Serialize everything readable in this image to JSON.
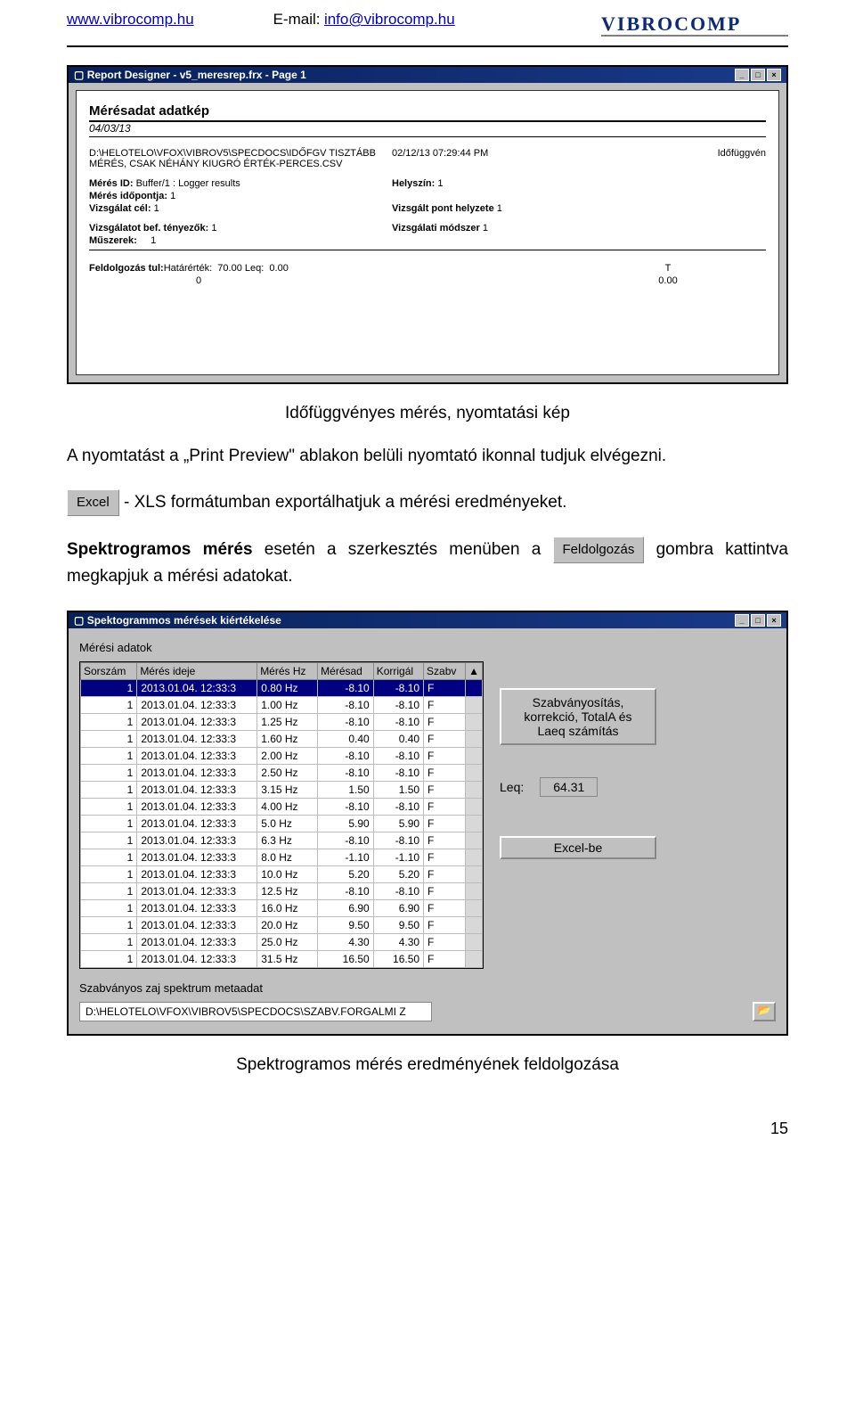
{
  "header": {
    "site_url": "www.vibrocomp.hu",
    "email_label": "E-mail:",
    "email": "info@vibrocomp.hu",
    "logo_text": "VIBROCOMP"
  },
  "win1": {
    "title": "Report Designer - v5_meresrep.frx - Page 1",
    "report": {
      "heading": "Mérésadat adatkép",
      "date": "04/03/13",
      "path1": "D:\\HELOTELO\\VFOX\\VIBROV5\\SPECDOCS\\IDŐFGV TISZTÁBB",
      "path2": "MÉRÉS, CSAK NÉHÁNY KIUGRÓ ÉRTÉK-PERCES.CSV",
      "right_ts": "02/12/13 07:29:44 PM",
      "right_type": "Időfüggvén",
      "meres_id_l": "Mérés ID:",
      "meres_id_v": "Buffer/1 : Logger results",
      "helyszin_l": "Helyszín:",
      "helyszin_v": "1",
      "idopont_l": "Mérés időpontja:",
      "idopont_v": "1",
      "vizsgcel_l": "Vizsgálat cél:",
      "vizsgcel_v": "1",
      "vpont_l": "Vizsgált pont helyzete",
      "vpont_v": "1",
      "bef_l": "Vizsgálatot bef. tényezők:",
      "bef_v": "1",
      "modszer_l": "Vizsgálati módszer",
      "modszer_v": "1",
      "muszerek_l": "Műszerek:",
      "muszerek_v": "1",
      "feld_l": "Feldolgozás tul:",
      "hatar_l": "Határérték:",
      "hatar_v": "70.00",
      "leq_l": "Leq:",
      "leq_v": "0.00",
      "t_label": "T",
      "zero_left": "0",
      "zero_right": "0.00"
    }
  },
  "caption1": "Időfüggvényes mérés, nyomtatási kép",
  "para1_a": "A nyomtatást a „Print Preview\" ablakon belüli nyomtató ikonnal tudjuk elvégezni.",
  "excel_btn": "Excel",
  "para1_b": " - XLS formátumban exportálhatjuk a mérési eredményeket.",
  "para2_a": "Spektrogramos mérés",
  "para2_b": " esetén a szerkesztés menüben a ",
  "feld_btn": "Feldolgozás",
  "para2_c": " gombra kattintva megkapjuk a mérési adatokat.",
  "win2": {
    "title": "Spektogrammos mérések kiértékelése",
    "label_adatok": "Mérési adatok",
    "columns": [
      "Sorszám",
      "Mérés ideje",
      "Mérés Hz",
      "Mérésad",
      "Korrigál",
      "Szabv"
    ],
    "rows": [
      [
        "1",
        "2013.01.04. 12:33:3",
        "0.80 Hz",
        "-8.10",
        "-8.10",
        "F"
      ],
      [
        "1",
        "2013.01.04. 12:33:3",
        "1.00 Hz",
        "-8.10",
        "-8.10",
        "F"
      ],
      [
        "1",
        "2013.01.04. 12:33:3",
        "1.25 Hz",
        "-8.10",
        "-8.10",
        "F"
      ],
      [
        "1",
        "2013.01.04. 12:33:3",
        "1.60 Hz",
        "0.40",
        "0.40",
        "F"
      ],
      [
        "1",
        "2013.01.04. 12:33:3",
        "2.00 Hz",
        "-8.10",
        "-8.10",
        "F"
      ],
      [
        "1",
        "2013.01.04. 12:33:3",
        "2.50 Hz",
        "-8.10",
        "-8.10",
        "F"
      ],
      [
        "1",
        "2013.01.04. 12:33:3",
        "3.15 Hz",
        "1.50",
        "1.50",
        "F"
      ],
      [
        "1",
        "2013.01.04. 12:33:3",
        "4.00 Hz",
        "-8.10",
        "-8.10",
        "F"
      ],
      [
        "1",
        "2013.01.04. 12:33:3",
        "5.0 Hz",
        "5.90",
        "5.90",
        "F"
      ],
      [
        "1",
        "2013.01.04. 12:33:3",
        "6.3 Hz",
        "-8.10",
        "-8.10",
        "F"
      ],
      [
        "1",
        "2013.01.04. 12:33:3",
        "8.0 Hz",
        "-1.10",
        "-1.10",
        "F"
      ],
      [
        "1",
        "2013.01.04. 12:33:3",
        "10.0 Hz",
        "5.20",
        "5.20",
        "F"
      ],
      [
        "1",
        "2013.01.04. 12:33:3",
        "12.5 Hz",
        "-8.10",
        "-8.10",
        "F"
      ],
      [
        "1",
        "2013.01.04. 12:33:3",
        "16.0 Hz",
        "6.90",
        "6.90",
        "F"
      ],
      [
        "1",
        "2013.01.04. 12:33:3",
        "20.0 Hz",
        "9.50",
        "9.50",
        "F"
      ],
      [
        "1",
        "2013.01.04. 12:33:3",
        "25.0 Hz",
        "4.30",
        "4.30",
        "F"
      ],
      [
        "1",
        "2013.01.04. 12:33:3",
        "31.5 Hz",
        "16.50",
        "16.50",
        "F"
      ]
    ],
    "side_btn1": "Szabványosítás, korrekció, TotalA és Laeq számítás",
    "leq_label": "Leq:",
    "leq_value": "64.31",
    "side_btn2": "Excel-be",
    "meta_label": "Szabványos zaj spektrum metaadat",
    "path": "D:\\HELOTELO\\VFOX\\VIBROV5\\SPECDOCS\\SZABV.FORGALMI Z",
    "open_icon": "📂"
  },
  "caption2": "Spektrogramos mérés eredményének feldolgozása",
  "page_number": "15"
}
